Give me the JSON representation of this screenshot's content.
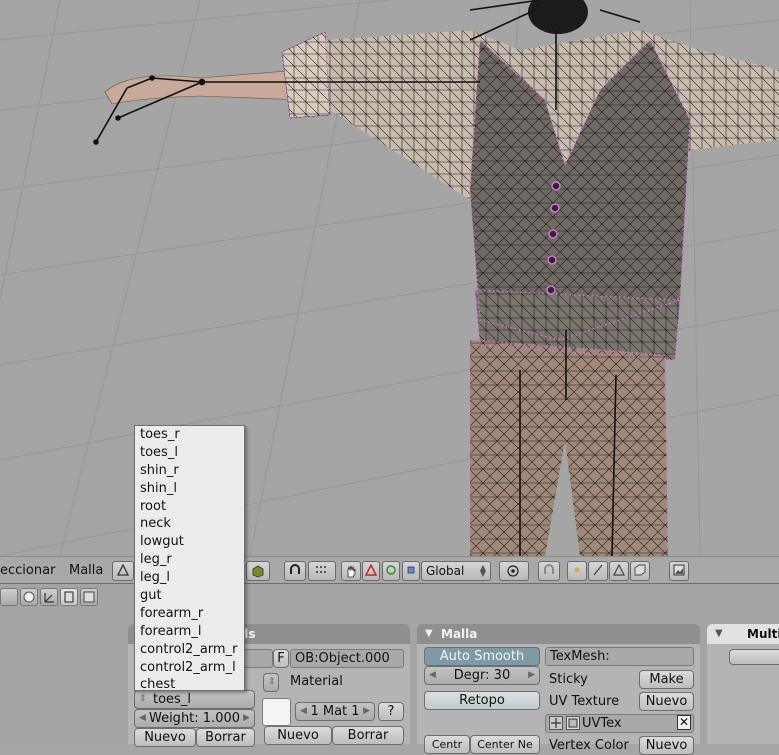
{
  "header": {
    "select_menu": "eccionar",
    "mesh_menu": "Malla",
    "orientation": "Global"
  },
  "vertex_groups": {
    "items": [
      "toes_r",
      "toes_l",
      "shin_r",
      "shin_l",
      "root",
      "neck",
      "lowgut",
      "leg_r",
      "leg_l",
      "gut",
      "forearm_r",
      "forearm_l",
      "control2_arm_r",
      "control2_arm_l",
      "chest"
    ],
    "active": "toes_l",
    "weight": "Weight: 1.000",
    "new_label": "Nuevo",
    "delete_label": "Borrar"
  },
  "link_materials": {
    "title_fragment": "erials",
    "f_button": "F",
    "object_field": "OB:Object.000",
    "material_label": "Material",
    "mat_index": "1 Mat 1",
    "help_button": "?",
    "new_label": "Nuevo",
    "delete_label": "Borrar"
  },
  "mesh_panel": {
    "title": "Malla",
    "auto_smooth": "Auto Smooth",
    "degr": "Degr: 30",
    "retopo": "Retopo",
    "texmesh": "TexMesh:",
    "sticky": "Sticky",
    "make": "Make",
    "uv_texture": "UV Texture",
    "uv_new": "Nuevo",
    "uvtex": "UVTex",
    "centre": "Centr",
    "center_new": "Center Ne",
    "vertex_color": "Vertex Color",
    "vc_new": "Nuevo"
  },
  "multires_panel": {
    "title": "Multi"
  },
  "colors": {
    "viewport_bg": "#a5a5a5",
    "wire": "#111111",
    "vertex_select": "#e070e0",
    "panel_header": "#8f8f8f",
    "auto_smooth_bg": "#7d9aa6"
  }
}
